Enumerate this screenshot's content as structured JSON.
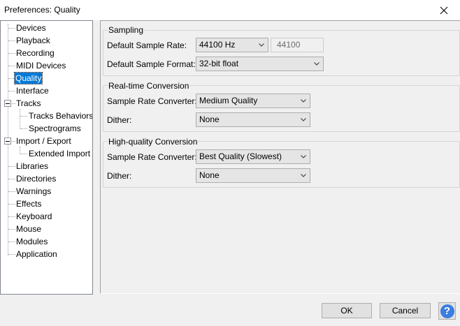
{
  "window": {
    "title": "Preferences: Quality"
  },
  "tree": {
    "items": [
      {
        "label": "Devices"
      },
      {
        "label": "Playback"
      },
      {
        "label": "Recording"
      },
      {
        "label": "MIDI Devices"
      },
      {
        "label": "Quality"
      },
      {
        "label": "Interface"
      },
      {
        "label": "Tracks"
      },
      {
        "label": "Tracks Behaviors"
      },
      {
        "label": "Spectrograms"
      },
      {
        "label": "Import / Export"
      },
      {
        "label": "Extended Import"
      },
      {
        "label": "Libraries"
      },
      {
        "label": "Directories"
      },
      {
        "label": "Warnings"
      },
      {
        "label": "Effects"
      },
      {
        "label": "Keyboard"
      },
      {
        "label": "Mouse"
      },
      {
        "label": "Modules"
      },
      {
        "label": "Application"
      }
    ],
    "selected": "Quality"
  },
  "sampling": {
    "title": "Sampling",
    "rate_label": "Default Sample Rate:",
    "rate_value": "44100 Hz",
    "rate_text": "44100",
    "format_label": "Default Sample Format:",
    "format_value": "32-bit float"
  },
  "realtime": {
    "title": "Real-time Conversion",
    "converter_label": "Sample Rate Converter:",
    "converter_value": "Medium Quality",
    "dither_label": "Dither:",
    "dither_value": "None"
  },
  "highquality": {
    "title": "High-quality Conversion",
    "converter_label": "Sample Rate Converter:",
    "converter_value": "Best Quality (Slowest)",
    "dither_label": "Dither:",
    "dither_value": "None"
  },
  "buttons": {
    "ok": "OK",
    "cancel": "Cancel",
    "help": "?"
  },
  "colors": {
    "selection": "#0078d7",
    "help": "#3b7de0"
  }
}
